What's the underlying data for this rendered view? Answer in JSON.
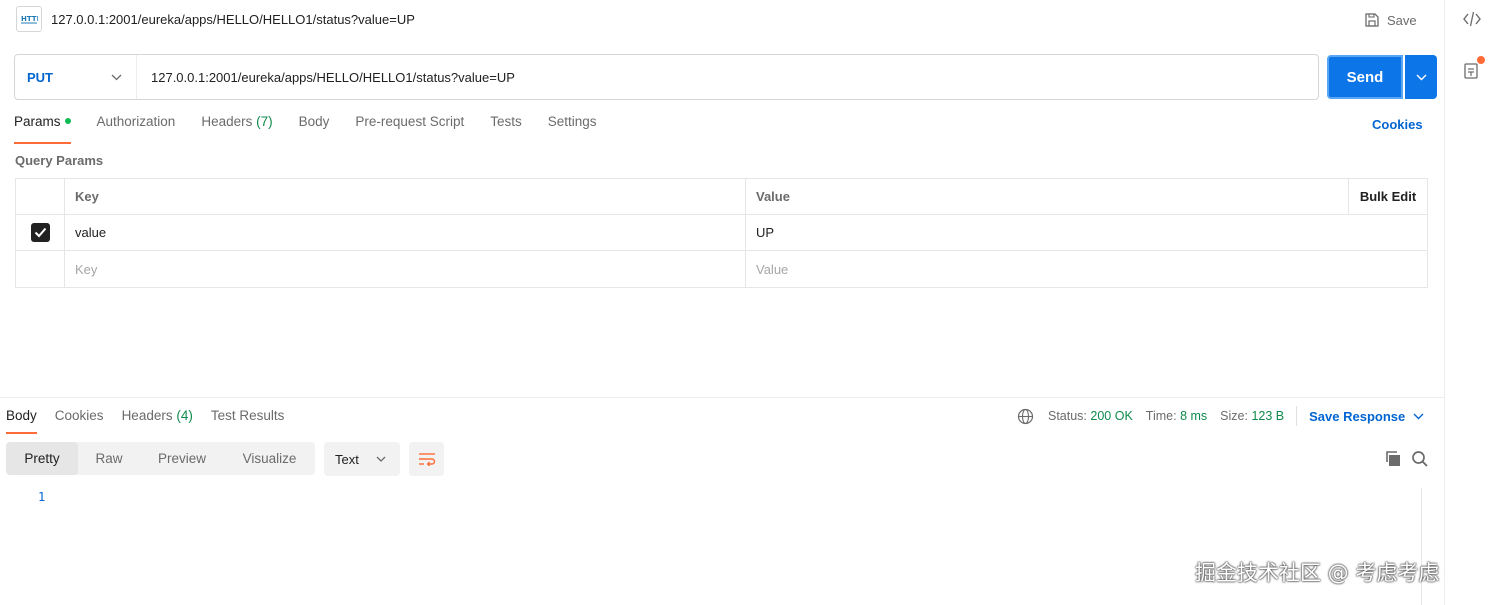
{
  "request": {
    "title": "127.0.0.1:2001/eureka/apps/HELLO/HELLO1/status?value=UP",
    "save_label": "Save",
    "method": "PUT",
    "url": "127.0.0.1:2001/eureka/apps/HELLO/HELLO1/status?value=UP",
    "send_label": "Send",
    "icon": "http-icon"
  },
  "request_tabs": {
    "params": "Params",
    "authorization": "Authorization",
    "headers": "Headers",
    "headers_count": "(7)",
    "body": "Body",
    "prerequest": "Pre-request Script",
    "tests": "Tests",
    "settings": "Settings",
    "cookies": "Cookies"
  },
  "query_params": {
    "title": "Query Params",
    "header_key": "Key",
    "header_value": "Value",
    "bulk_edit": "Bulk Edit",
    "rows": [
      {
        "checked": true,
        "key": "value",
        "value": "UP"
      }
    ],
    "placeholder_key": "Key",
    "placeholder_value": "Value"
  },
  "response_tabs": {
    "body": "Body",
    "cookies": "Cookies",
    "headers": "Headers",
    "headers_count": "(4)",
    "test_results": "Test Results"
  },
  "response_meta": {
    "status_label": "Status:",
    "status_value": "200 OK",
    "time_label": "Time:",
    "time_value": "8 ms",
    "size_label": "Size:",
    "size_value": "123 B",
    "save_response": "Save Response"
  },
  "response_view": {
    "pretty": "Pretty",
    "raw": "Raw",
    "preview": "Preview",
    "visualize": "Visualize",
    "format": "Text",
    "line_number": "1"
  },
  "watermark": "掘金技术社区 @ 考虑考虑",
  "colors": {
    "accent": "#ff6c37",
    "primary": "#0c75e8",
    "link": "#0265d2",
    "success": "#0f8a4c"
  }
}
